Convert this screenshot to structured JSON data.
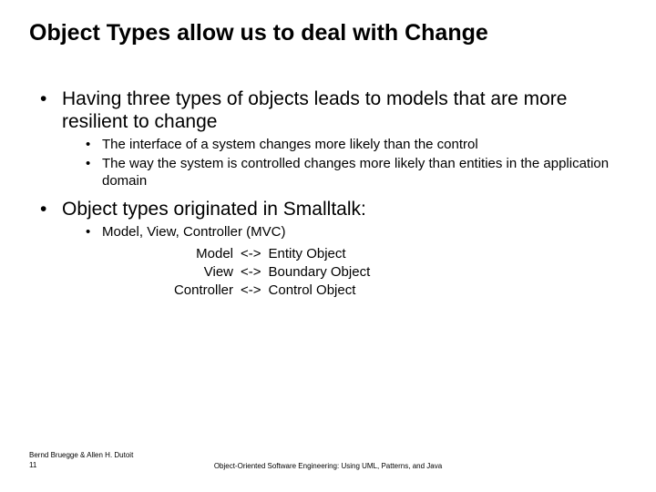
{
  "title": "Object Types allow us to deal with Change",
  "bullets": {
    "b1": "Having three types of objects leads to models that are more resilient to change",
    "b1_1": "The interface of a system changes more likely than the control",
    "b1_2": "The way the system is controlled changes more likely than entities in the application domain",
    "b2": "Object types originated in Smalltalk:",
    "b2_1": "Model, View, Controller (MVC)"
  },
  "mvc": {
    "rows": [
      {
        "left": "Model",
        "arrow": "<->",
        "right": "Entity Object"
      },
      {
        "left": "View",
        "arrow": "<->",
        "right": "Boundary Object"
      },
      {
        "left": "Controller",
        "arrow": "<->",
        "right": "Control Object"
      }
    ]
  },
  "footer": {
    "authors": "Bernd Bruegge & Allen H. Dutoit",
    "page": "11",
    "center": "Object-Oriented Software Engineering: Using UML, Patterns, and Java"
  }
}
